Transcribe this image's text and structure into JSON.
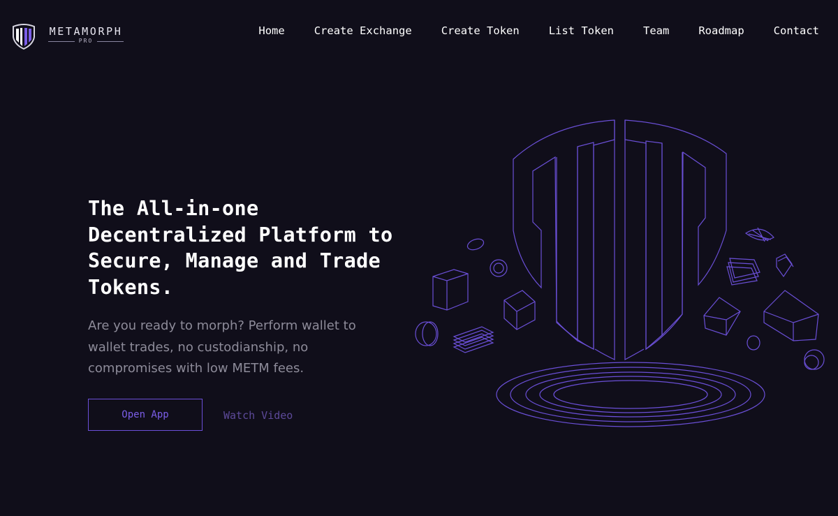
{
  "brand": {
    "name": "METAMORPH",
    "subtitle": "PRO",
    "logo_icon": "shield-logo-icon",
    "accent": "#7b5ee8"
  },
  "nav": {
    "items": [
      {
        "label": "Home"
      },
      {
        "label": "Create Exchange"
      },
      {
        "label": "Create Token"
      },
      {
        "label": "List Token"
      },
      {
        "label": "Team"
      },
      {
        "label": "Roadmap"
      },
      {
        "label": "Contact"
      }
    ]
  },
  "hero": {
    "title": "The All-in-one Decentralized Platform to Secure, Manage and Trade Tokens.",
    "description": "Are you ready to morph? Perform wallet to wallet trades, no custodianship, no compromises with low METM fees.",
    "primary_button": "Open App",
    "secondary_button": "Watch Video",
    "illustration_icon": "metamorph-shield-portal-illustration"
  },
  "colors": {
    "background": "#100e1a",
    "accent": "#7b5ee8",
    "line": "#6a4fd6",
    "text_muted": "#8d8b99"
  }
}
